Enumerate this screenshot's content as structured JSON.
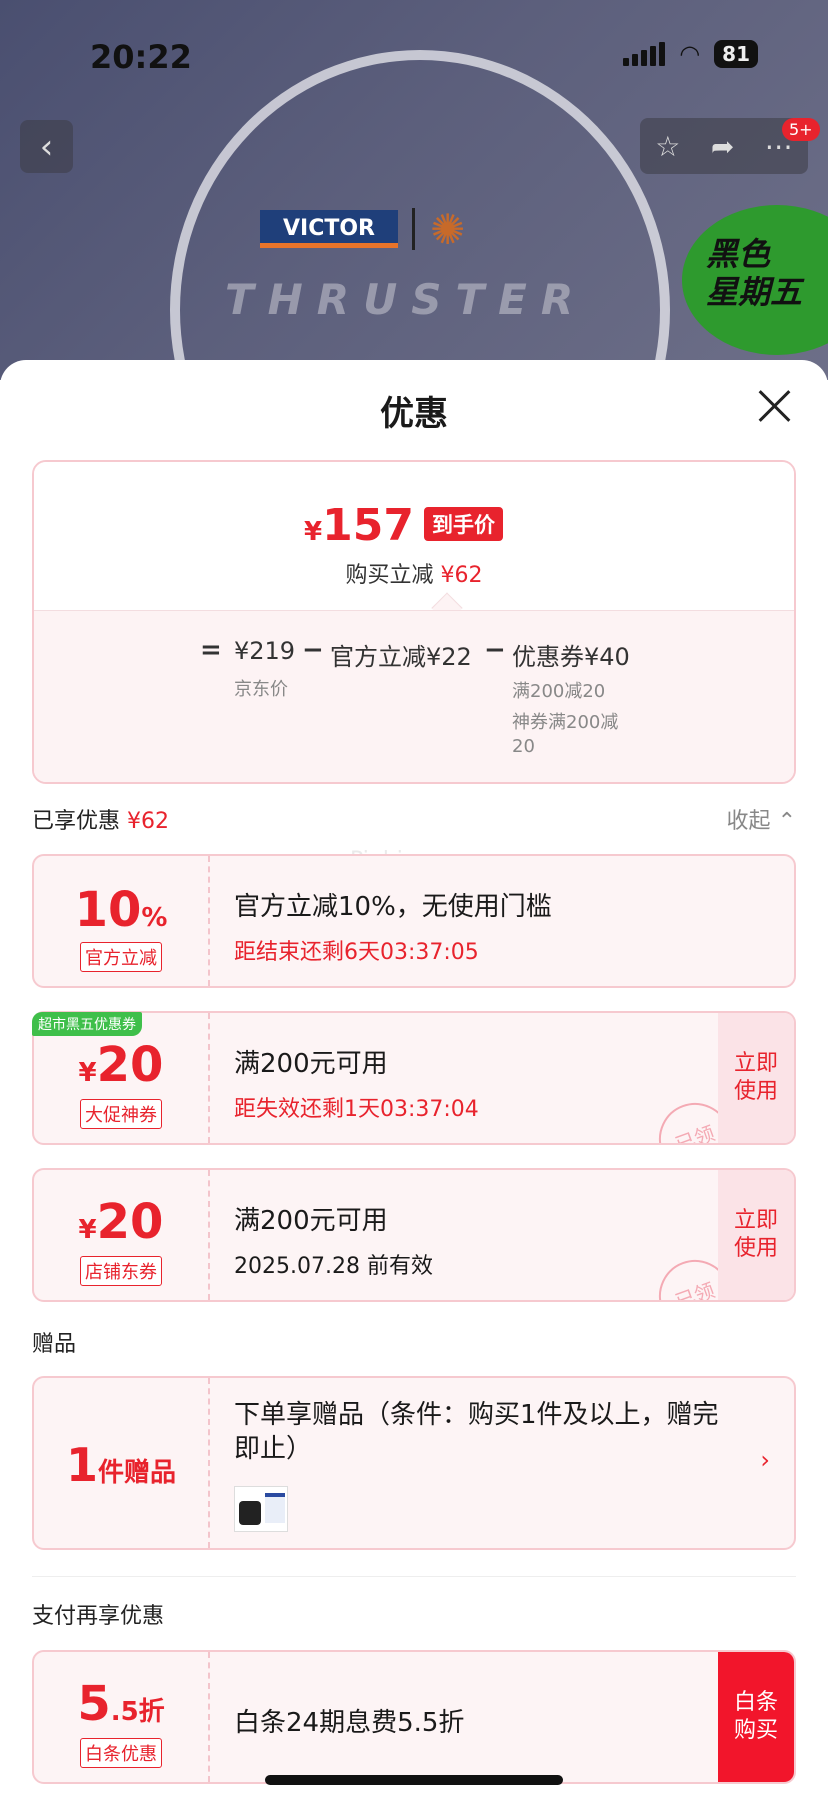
{
  "status": {
    "time": "20:22",
    "battery": "81"
  },
  "nav": {
    "back_icon": "‹",
    "badge": "5+"
  },
  "banner": {
    "brand": "VICTOR",
    "series": "THRUSTER",
    "promo": "黑色\n星期五"
  },
  "sheet": {
    "title": "优惠",
    "summary": {
      "yen": "¥",
      "final_price": "157",
      "final_tag": "到手价",
      "sub_label": "购买立减",
      "sub_amount": "¥62",
      "eq": "=",
      "jd_price": "¥219",
      "jd_label": "京东价",
      "minus1": "−",
      "official": "官方立减¥22",
      "minus2": "−",
      "coupon": "优惠券¥40",
      "coupon_note1": "满200减20",
      "coupon_note2": "神券满200减\n20"
    },
    "enjoyed": {
      "label": "已享优惠",
      "amount": "¥62",
      "collapse": "收起"
    },
    "coupons": [
      {
        "value": "10",
        "unit": "%",
        "label": "官方立减",
        "title": "官方立减10%，无使用门槛",
        "sub": "距结束还剩6天03:37:05"
      },
      {
        "tag": "超市黑五优惠券",
        "yen": "¥",
        "value": "20",
        "label": "大促神券",
        "title": "满200元可用",
        "sub": "距失效还剩1天03:37:04",
        "stamp": "已领",
        "action": "立即\n使用"
      },
      {
        "yen": "¥",
        "value": "20",
        "label": "店铺东券",
        "title": "满200元可用",
        "sub": "2025.07.28 前有效",
        "stamp": "已领",
        "action": "立即\n使用"
      }
    ],
    "gift": {
      "section": "赠品",
      "count": "1",
      "unit": "件赠品",
      "title": "下单享赠品（条件：购买1件及以上，赠完即止）"
    },
    "pay": {
      "section": "支付再享优惠",
      "value": "5",
      "unit": ".5折",
      "label": "白条优惠",
      "title": "白条24期息费5.5折",
      "action": "白条\n购买"
    },
    "watermark": "Piubiu"
  }
}
